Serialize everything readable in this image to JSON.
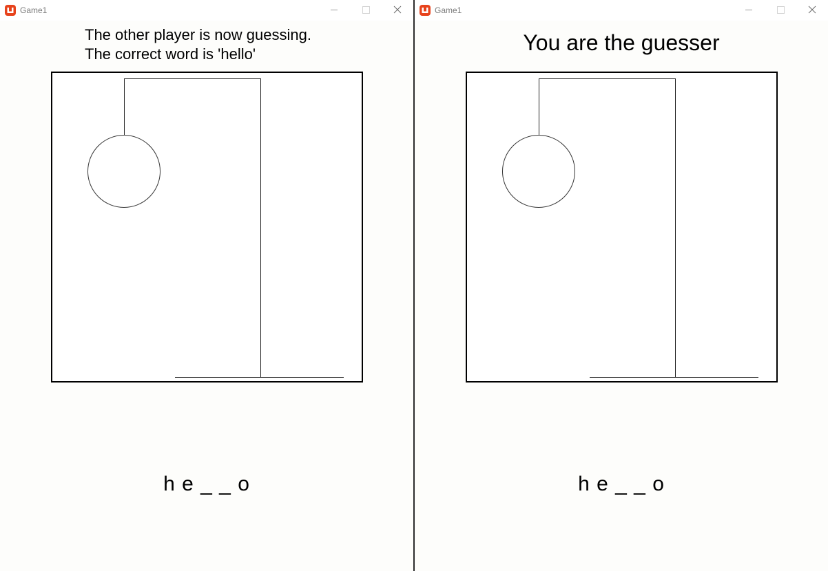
{
  "windows": [
    {
      "title": "Game1",
      "icon": "monogame-icon",
      "accent": "#e7431c",
      "status_lines": [
        "The other player is now guessing.",
        "The correct word is 'hello'"
      ],
      "word_display": "h e _ _ o",
      "hangman_stage": "head"
    },
    {
      "title": "Game1",
      "icon": "monogame-icon",
      "accent": "#e7431c",
      "status_title": "You are the guesser",
      "word_display": "h e _ _ o",
      "hangman_stage": "head"
    }
  ]
}
